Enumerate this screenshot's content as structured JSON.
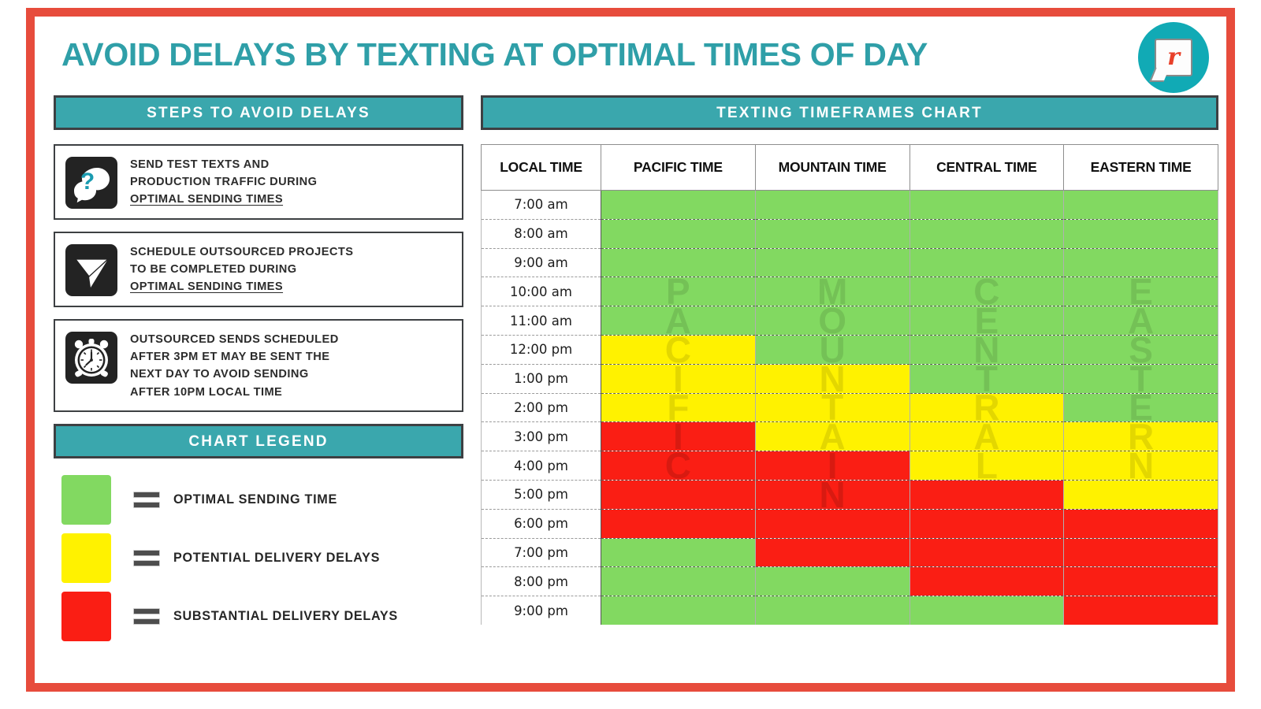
{
  "header": {
    "title": "AVOID DELAYS BY TEXTING AT OPTIMAL TIMES OF DAY",
    "logo_letter": "r"
  },
  "left_panel": {
    "steps_heading": "STEPS TO AVOID DELAYS",
    "steps": [
      {
        "icon": "question-speech-bubble-icon",
        "lines": [
          "SEND TEST TEXTS AND",
          "PRODUCTION TRAFFIC DURING"
        ],
        "underlined": "OPTIMAL SENDING TIMES"
      },
      {
        "icon": "paper-plane-send-icon",
        "lines": [
          "SCHEDULE OUTSOURCED PROJECTS",
          "TO BE COMPLETED DURING"
        ],
        "underlined": "OPTIMAL SENDING TIMES"
      },
      {
        "icon": "alarm-clock-icon",
        "lines": [
          "OUTSOURCED SENDS SCHEDULED",
          "AFTER 3PM ET MAY BE SENT THE",
          "NEXT DAY TO AVOID SENDING",
          "AFTER 10PM LOCAL TIME"
        ],
        "underlined": ""
      }
    ],
    "legend_heading": "CHART LEGEND",
    "legend": [
      {
        "color": "#82d961",
        "label": "OPTIMAL SENDING TIME",
        "equals": "="
      },
      {
        "color": "#fff200",
        "label": "POTENTIAL DELIVERY DELAYS",
        "equals": "="
      },
      {
        "color": "#fa1e14",
        "label": "SUBSTANTIAL DELIVERY DELAYS",
        "equals": "="
      }
    ]
  },
  "chart_data": {
    "type": "heatmap",
    "title": "TEXTING TIMEFRAMES CHART",
    "columns": [
      "LOCAL TIME",
      "PACIFIC TIME",
      "MOUNTAIN TIME",
      "CENTRAL TIME",
      "EASTERN TIME"
    ],
    "watermarks": [
      "PACIFIC",
      "MOUNTAIN",
      "CENTRAL",
      "EASTERN"
    ],
    "rows": [
      "7:00 am",
      "8:00 am",
      "9:00 am",
      "10:00 am",
      "11:00 am",
      "12:00 pm",
      "1:00 pm",
      "2:00 pm",
      "3:00 pm",
      "4:00 pm",
      "5:00 pm",
      "6:00 pm",
      "7:00 pm",
      "8:00 pm",
      "9:00 pm"
    ],
    "status_colors": {
      "optimal": "#82d961",
      "potential": "#fff200",
      "substantial": "#fa1e14"
    },
    "series": [
      {
        "name": "PACIFIC TIME",
        "values": [
          "optimal",
          "optimal",
          "optimal",
          "optimal",
          "optimal",
          "potential",
          "potential",
          "potential",
          "substantial",
          "substantial",
          "substantial",
          "substantial",
          "optimal",
          "optimal",
          "optimal"
        ]
      },
      {
        "name": "MOUNTAIN TIME",
        "values": [
          "optimal",
          "optimal",
          "optimal",
          "optimal",
          "optimal",
          "optimal",
          "potential",
          "potential",
          "potential",
          "substantial",
          "substantial",
          "substantial",
          "substantial",
          "optimal",
          "optimal"
        ]
      },
      {
        "name": "CENTRAL TIME",
        "values": [
          "optimal",
          "optimal",
          "optimal",
          "optimal",
          "optimal",
          "optimal",
          "optimal",
          "potential",
          "potential",
          "potential",
          "substantial",
          "substantial",
          "substantial",
          "substantial",
          "optimal"
        ]
      },
      {
        "name": "EASTERN TIME",
        "values": [
          "optimal",
          "optimal",
          "optimal",
          "optimal",
          "optimal",
          "optimal",
          "optimal",
          "optimal",
          "potential",
          "potential",
          "potential",
          "substantial",
          "substantial",
          "substantial",
          "substantial"
        ]
      }
    ]
  },
  "theme": {
    "frame": "#e74c3c",
    "teal": "#3aa7ad",
    "title_teal": "#2f9fa8",
    "logo_teal": "#11aab5",
    "logo_red": "#e8402a"
  }
}
